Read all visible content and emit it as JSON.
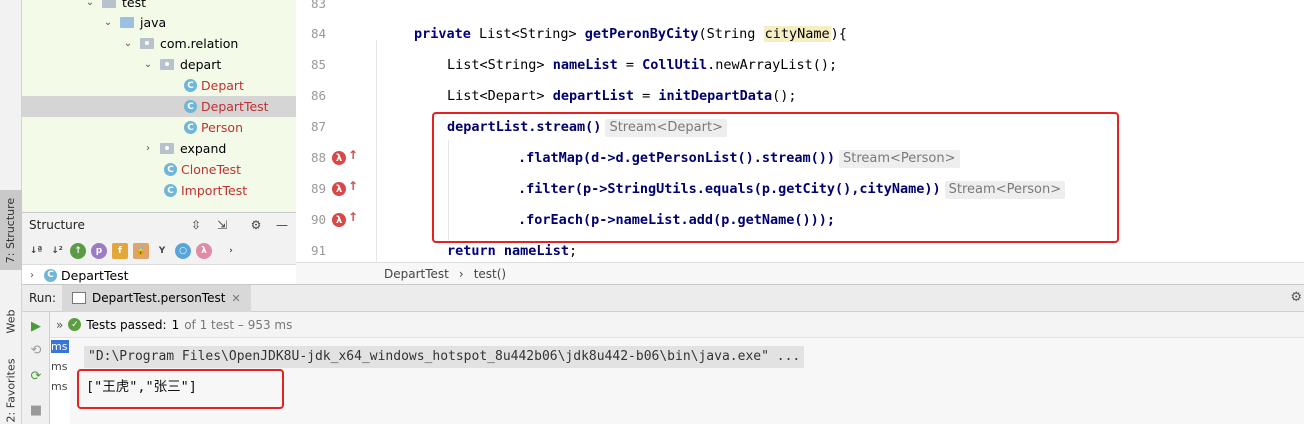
{
  "side_tabs": {
    "structure": "7: Structure",
    "web": "Web",
    "favorites": "2: Favorites"
  },
  "project_tree": {
    "items": [
      {
        "label": "test",
        "kind": "folder"
      },
      {
        "label": "java",
        "kind": "src-folder"
      },
      {
        "label": "com.relation",
        "kind": "package"
      },
      {
        "label": "depart",
        "kind": "package"
      },
      {
        "label": "Depart",
        "kind": "class"
      },
      {
        "label": "DepartTest",
        "kind": "class"
      },
      {
        "label": "Person",
        "kind": "class"
      },
      {
        "label": "expand",
        "kind": "package"
      },
      {
        "label": "CloneTest",
        "kind": "class"
      },
      {
        "label": "ImportTest",
        "kind": "class"
      }
    ]
  },
  "structure": {
    "title": "Structure",
    "item": "DepartTest"
  },
  "editor": {
    "line_numbers": [
      "83",
      "84",
      "85",
      "86",
      "87",
      "88",
      "89",
      "90",
      "91"
    ],
    "lines": {
      "l84": {
        "kw": "private",
        "type": "List<String>",
        "name": "getPeronByCity",
        "open": "(String ",
        "param": "cityName",
        "close": "){"
      },
      "l85": {
        "type": "List<String>",
        "var": "nameList",
        "mid": " = ",
        "call": "CollUtil",
        "rest": ".newArrayList();"
      },
      "l86": {
        "type": "List<Depart>",
        "var": "departList",
        "mid": " = ",
        "call": "initDepartData",
        "rest": "();"
      },
      "l87": {
        "code": "departList.stream()",
        "hint": "Stream<Depart>"
      },
      "l88": {
        "code": ".flatMap(d->d.getPersonList().stream())",
        "hint": "Stream<Person>"
      },
      "l89": {
        "code": ".filter(p->StringUtils.equals(p.getCity(),cityName))",
        "hint": "Stream<Person>"
      },
      "l90": {
        "code": ".forEach(p->nameList.add(p.getName()));"
      },
      "l91": {
        "kw": "return",
        "var": "nameList",
        "rest": ";"
      }
    },
    "gutter_marks": [
      "λ",
      "λ",
      "λ"
    ]
  },
  "breadcrumb": {
    "class": "DepartTest",
    "method": "test()"
  },
  "run": {
    "label": "Run:",
    "tab": "DepartTest.personTest",
    "tests_passed_label": "Tests passed:",
    "tests_passed_count": "1",
    "tests_passed_rest": "of 1 test – 953 ms",
    "ms_labels": [
      "ms",
      "ms",
      "ms"
    ],
    "command": "\"D:\\Program Files\\OpenJDK8U-jdk_x64_windows_hotspot_8u442b06\\jdk8u442-b06\\bin\\java.exe\" ...",
    "output": "[\"王虎\",\"张三\"]"
  },
  "colors": {
    "highlight_box": "#e52222",
    "tree_bg": "#f3fbe8",
    "selection": "#3875d7"
  }
}
